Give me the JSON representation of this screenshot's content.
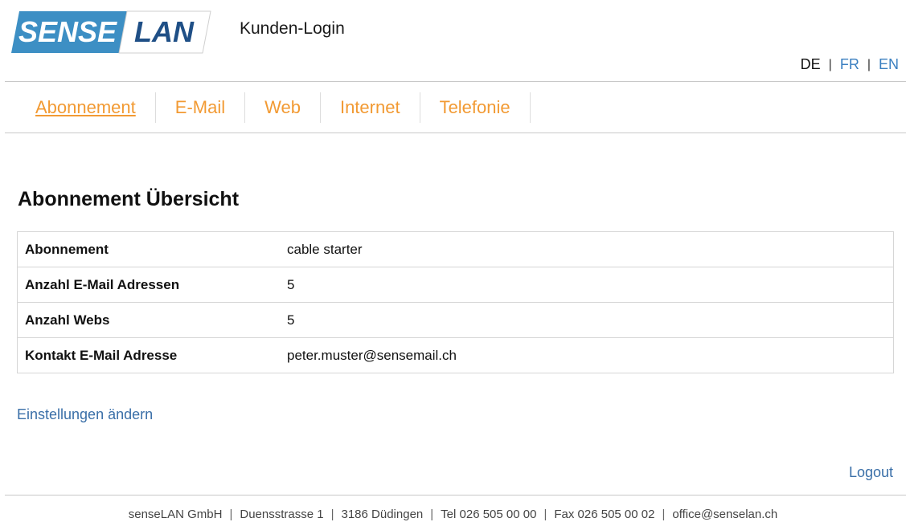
{
  "header": {
    "logo_text_1": "SENSE",
    "logo_text_2": "LAN",
    "title": "Kunden-Login"
  },
  "languages": {
    "items": [
      "DE",
      "FR",
      "EN"
    ],
    "active": "DE"
  },
  "nav": {
    "items": [
      "Abonnement",
      "E-Mail",
      "Web",
      "Internet",
      "Telefonie"
    ],
    "active": "Abonnement"
  },
  "main": {
    "heading": "Abonnement Übersicht",
    "rows": [
      {
        "label": "Abonnement",
        "value": "cable starter"
      },
      {
        "label": "Anzahl E-Mail Adressen",
        "value": "5"
      },
      {
        "label": "Anzahl Webs",
        "value": "5"
      },
      {
        "label": "Kontakt E-Mail Adresse",
        "value": "peter.muster@sensemail.ch"
      }
    ],
    "settings_link": "Einstellungen ändern",
    "logout": "Logout"
  },
  "footer": {
    "company": "senseLAN GmbH",
    "street": "Duensstrasse 1",
    "city": "3186 Düdingen",
    "tel": "Tel 026 505 00 00",
    "fax": "Fax 026 505 00 02",
    "email": "office@senselan.ch"
  },
  "colors": {
    "brand_blue": "#3d8fc4",
    "nav_orange": "#f29a33",
    "link_blue": "#3a6fa8"
  }
}
